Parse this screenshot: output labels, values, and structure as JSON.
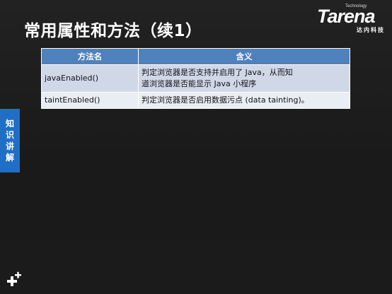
{
  "slide": {
    "title": "常用属性和方法（续1）"
  },
  "logo": {
    "brand": "Tarena",
    "tagline_small": "Technology",
    "tagline_cn": "达内科技"
  },
  "side_tab": {
    "chars": [
      "知",
      "识",
      "讲",
      "解"
    ]
  },
  "table": {
    "headers": [
      "方法名",
      "含义"
    ],
    "rows": [
      {
        "name": "javaEnabled()",
        "meaning_line1": "判定浏览器是否支持并启用了 Java，从而知",
        "meaning_line2": "道浏览器是否能显示 Java 小程序"
      },
      {
        "name": "taintEnabled()",
        "meaning_line1": "判定浏览器是否启用数据污点 (data tainting)。",
        "meaning_line2": ""
      }
    ]
  },
  "colors": {
    "header_bg": "#4f81bd",
    "row_odd": "#d0d8e8",
    "row_even": "#e9edf4",
    "side_tab": "#1f6fc5",
    "background": "#1c1c1c"
  },
  "icons": {
    "corner": "plus-icon"
  }
}
